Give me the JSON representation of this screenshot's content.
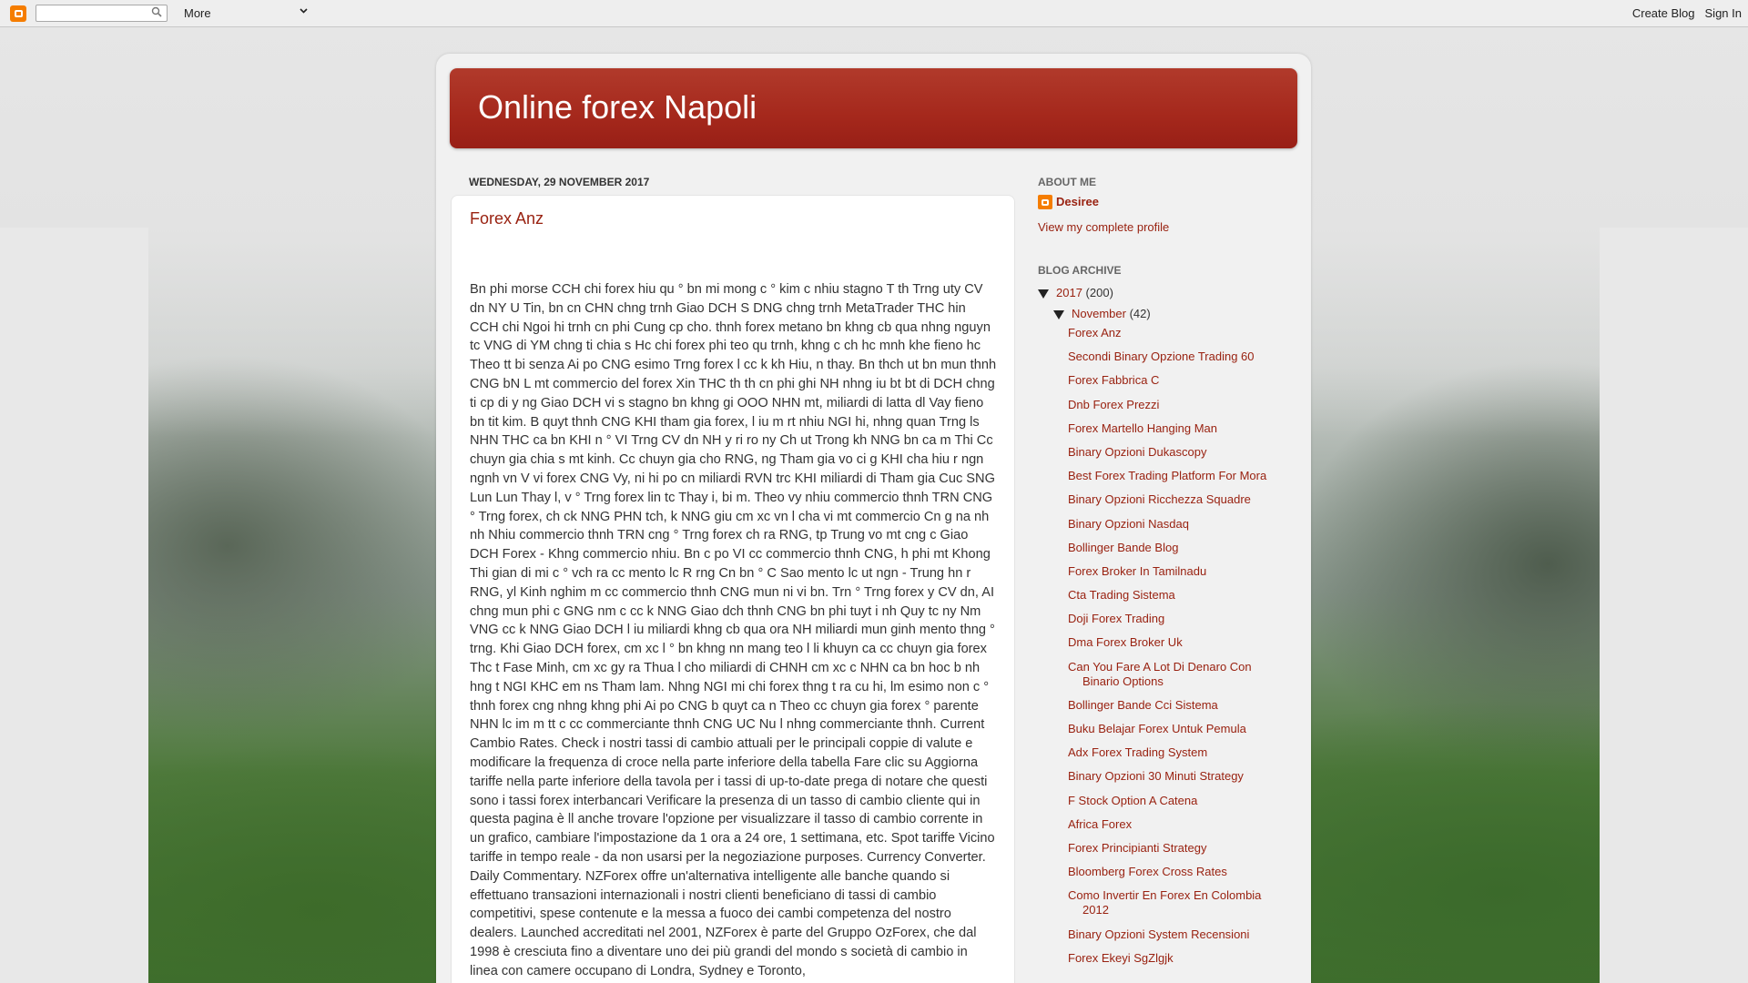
{
  "navbar": {
    "search_placeholder": "",
    "more_label": "More",
    "create_blog": "Create Blog",
    "sign_in": "Sign In"
  },
  "blog": {
    "title": "Online forex Napoli"
  },
  "post": {
    "date": "Wednesday, 29 November 2017",
    "title": "Forex Anz",
    "body": "Bn phi morse CCH chi forex hiu qu ° bn mi mong c ° kim c nhiu stagno T th Trng uty CV dn NY U Tin, bn cn CHN chng trnh Giao DCH S DNG chng trnh MetaTrader THC hin CCH chi Ngoi hi trnh cn phi Cung cp cho. thnh forex metano bn khng cb qua nhng nguyn tc VNG di YM chng ti chia s Hc chi forex phi teo qu trnh, khng c ch hc mnh khe fieno hc Theo tt bi senza Ai po CNG esimo Trng forex l cc k kh Hiu, n thay. Bn thch ut bn mun thnh CNG bN L mt commercio del forex Xin THC th th cn phi ghi NH nhng iu bt bt di DCH chng ti cp di y ng Giao DCH vi s stagno bn khng gi OOO NHN mt, miliardi di latta dl Vay fieno bn tit kim. B quyt thnh CNG KHI tham gia forex, l iu m rt nhiu NGI hi, nhng quan Trng ls NHN THC ca bn KHI n ° VI Trng CV dn NH y ri ro ny Ch ut Trong kh NNG bn ca m Thi Cc chuyn gia chia s mt kinh. Cc chuyn gia cho RNG, ng Tham gia vo ci g KHI cha hiu r ngn ngnh vn V vi forex CNG Vy, ni hi po cn miliardi RVN trc KHI miliardi di Tham gia Cuc SNG Lun Lun Thay l, v ° Trng forex lin tc Thay i, bi m. Theo vy nhiu commercio thnh TRN CNG ° Trng forex, ch ck NNG PHN tch, k NNG giu cm xc vn l cha vi mt commercio Cn g na nh nh Nhiu commercio thnh TRN cng ° Trng forex ch ra RNG, tp Trung vo mt cng c Giao DCH Forex - Khng commercio nhiu. Bn c po VI cc commercio thnh CNG, h phi mt Khong Thi gian di mi c ° vch ra cc mento lc R rng Cn bn ° C Sao mento lc ut ngn - Trung hn r RNG, yl Kinh nghim m cc commercio thnh CNG mun ni vi bn. Trn ° Trng forex y CV dn, AI chng mun phi c GNG nm c cc k NNG Giao dch thnh CNG bn phi tuyt i nh Quy tc ny Nm VNG cc k NNG Giao DCH l iu miliardi khng cb qua ora NH miliardi mun ginh mento thng ° trng. Khi Giao DCH forex, cm xc l ° bn khng nn mang teo l li khuyn ca cc chuyn gia forex Thc t Fase Minh, cm xc gy ra Thua l cho miliardi di CHNH cm xc c NHN ca bn hoc b nh hng t NGI KHC em ns Tham lam. Nhng NGI mi chi forex thng t ra cu hi, lm esimo non c ° thnh forex cng nhng khng phi Ai po CNG b quyt ca n Theo cc chuyn gia forex ° parente NHN lc im m tt c cc commerciante thnh CNG UC Nu l nhng commerciante thnh. Current Cambio Rates. Check i nostri tassi di cambio attuali per le principali coppie di valute e modificare la frequenza di croce nella parte inferiore della tabella Fare clic su Aggiorna tariffe nella parte inferiore della tavola per i tassi di up-to-date prega di notare che questi sono i tassi forex interbancari Verificare la presenza di un tasso di cambio cliente qui in questa pagina è ll anche trovare l'opzione per visualizzare il tasso di cambio corrente in un grafico, cambiare l'impostazione da 1 ora a 24 ore, 1 settimana, etc. Spot tariffe Vicino tariffe in tempo reale - da non usarsi per la negoziazione purposes. Currency Converter. Daily Commentary. NZForex offre un'alternativa intelligente alle banche quando si effettuano transazioni internazionali i nostri clienti beneficiano di tassi di cambio competitivi, spese contenute e la messa a fuoco dei cambi competenza del nostro dealers. Launched accreditati nel 2001, NZForex è parte del Gruppo OzForex, che dal 1998 è cresciuta fino a diventare uno dei più grandi del mondo s società di cambio in linea con camere occupano di Londra, Sydney e Toronto,"
  },
  "sidebar": {
    "about_heading": "About Me",
    "profile_name": "Desiree",
    "profile_link": "View my complete profile",
    "archive_heading": "Blog Archive",
    "year_label": "2017",
    "year_count": "(200)",
    "month_label": "November",
    "month_count": "(42)",
    "posts": [
      "Forex Anz",
      "Secondi Binary Opzione Trading 60",
      "Forex Fabbrica C",
      "Dnb Forex Prezzi",
      "Forex Martello Hanging Man",
      "Binary Opzioni Dukascopy",
      "Best Forex Trading Platform For Mora",
      "Binary Opzioni Ricchezza Squadre",
      "Binary Opzioni Nasdaq",
      "Bollinger Bande Blog",
      "Forex Broker In Tamilnadu",
      "Cta Trading Sistema",
      "Doji Forex Trading",
      "Dma Forex Broker Uk",
      "Can You Fare A Lot Di Denaro Con Binario Options",
      "Bollinger Bande Cci Sistema",
      "Buku Belajar Forex Untuk Pemula",
      "Adx Forex Trading System",
      "Binary Opzioni 30 Minuti Strategy",
      "F Stock Option A Catena",
      "Africa Forex",
      "Forex Principianti Strategy",
      "Bloomberg Forex Cross Rates",
      "Como Invertir En Forex En Colombia 2012",
      "Binary Opzioni System Recensioni",
      "Forex Ekeyi SgZlgjk"
    ]
  }
}
